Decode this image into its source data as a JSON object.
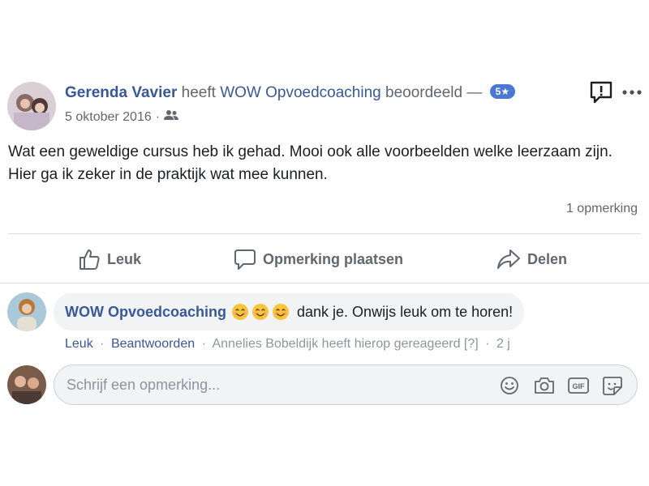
{
  "post": {
    "author": "Gerenda Vavier",
    "action_prefix": "heeft",
    "page_name": "WOW Opvoedcoaching",
    "action_suffix": "beoordeeld —",
    "rating_badge": "5★",
    "date": "5 oktober 2016",
    "privacy_icon": "friends-icon",
    "text": "Wat een geweldige cursus heb ik gehad. Mooi ook alle voorbeelden welke leerzaam zijn. Hier ga ik zeker in de praktijk wat mee kunnen.",
    "comment_count": "1 opmerking"
  },
  "actions": {
    "like": "Leuk",
    "comment": "Opmerking plaatsen",
    "share": "Delen"
  },
  "comment": {
    "author": "WOW Opvoedcoaching",
    "emoji_count": 3,
    "text": "dank je. Onwijs leuk om te horen!",
    "like": "Leuk",
    "reply": "Beantwoorden",
    "reaction_note": "Annelies Bobeldijk heeft hierop gereageerd",
    "help": "[?]",
    "age": "2 j"
  },
  "composer": {
    "placeholder": "Schrijf een opmerking...",
    "icons": [
      "emoji-icon",
      "camera-icon",
      "gif-icon",
      "sticker-icon"
    ]
  },
  "colors": {
    "link": "#385898",
    "muted": "#606770",
    "badge": "#4a77d4",
    "bubble": "#f2f3f5"
  }
}
